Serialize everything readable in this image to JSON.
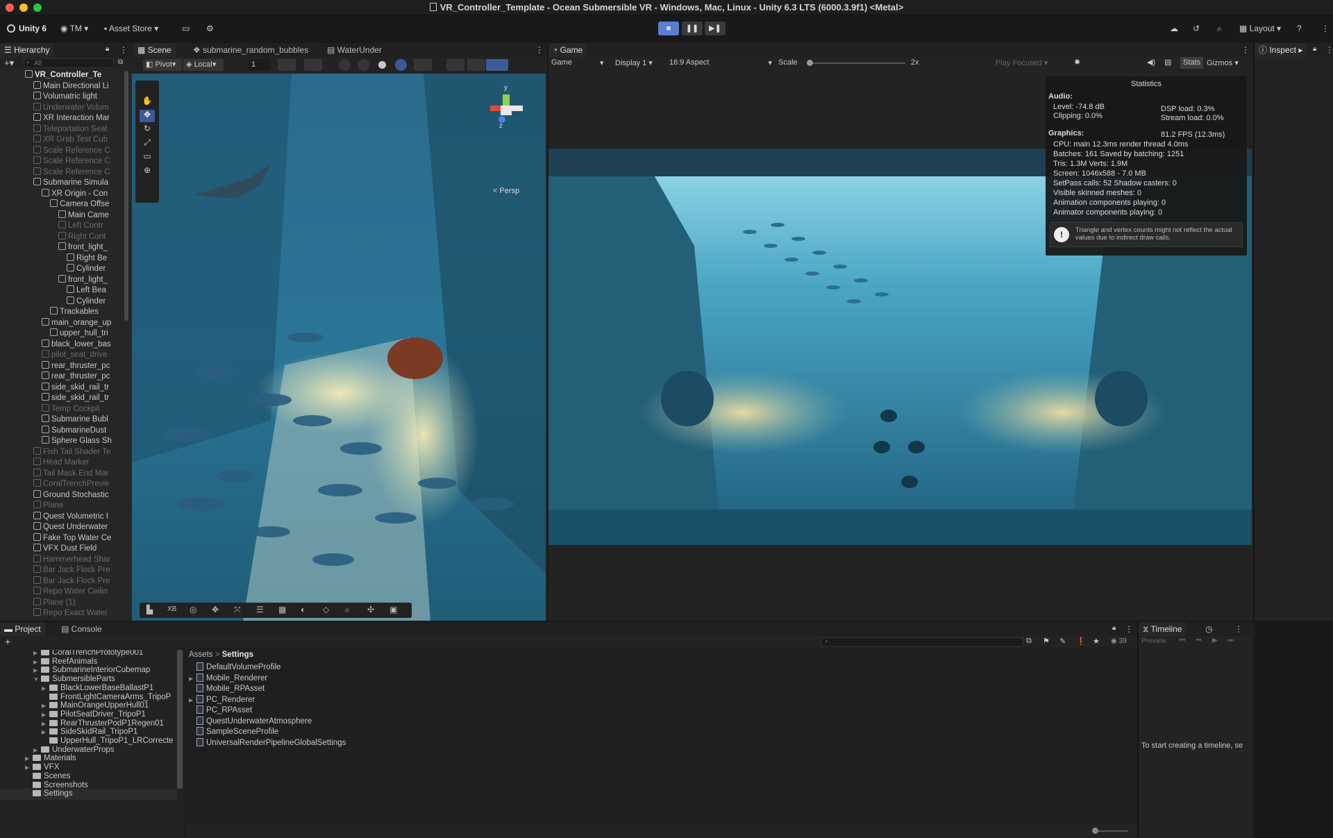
{
  "window": {
    "title": "VR_Controller_Template - Ocean Submersible VR - Windows, Mac, Linux - Unity 6.3 LTS (6000.3.9f1) <Metal>"
  },
  "toolbar": {
    "unity": "Unity 6",
    "account": "TM",
    "asset_store": "Asset Store",
    "layout": "Layout"
  },
  "scene_tabs": {
    "hierarchy": "Hierarchy",
    "scene": "Scene",
    "tab2": "submarine_random_bubbles",
    "tab3": "WaterUnder",
    "game": "Game",
    "inspector": "Inspect"
  },
  "scene_toolbar": {
    "pivot": "Pivot",
    "local": "Local",
    "snap": "1",
    "persp": "< Persp",
    "gizmo_y": "y",
    "gizmo_z": "z"
  },
  "game_toolbar": {
    "game": "Game",
    "display": "Display 1",
    "aspect": "16:9 Aspect",
    "scale": "Scale",
    "scale_val": "2x",
    "play_focused": "Play Focused",
    "stats": "Stats",
    "gizmos": "Gizmos"
  },
  "hierarchy": {
    "search_placeholder": "All",
    "items": [
      {
        "label": "VR_Controller_Te",
        "indent": 0,
        "arrow": "▼",
        "dim": false,
        "bold": true
      },
      {
        "label": "Main Directional Li",
        "indent": 1,
        "arrow": "",
        "dim": false
      },
      {
        "label": "Volumatric light",
        "indent": 1,
        "arrow": "",
        "dim": false
      },
      {
        "label": "Underwater Volum",
        "indent": 1,
        "arrow": "",
        "dim": true
      },
      {
        "label": "XR Interaction Mar",
        "indent": 1,
        "arrow": "",
        "dim": false
      },
      {
        "label": "Teleportation Seat",
        "indent": 1,
        "arrow": "",
        "dim": true
      },
      {
        "label": "XR Grab Test Cub",
        "indent": 1,
        "arrow": "",
        "dim": true
      },
      {
        "label": "Scale Reference C",
        "indent": 1,
        "arrow": "",
        "dim": true
      },
      {
        "label": "Scale Reference C",
        "indent": 1,
        "arrow": "",
        "dim": true
      },
      {
        "label": "Scale Reference C",
        "indent": 1,
        "arrow": "",
        "dim": true
      },
      {
        "label": "Submarine Simula",
        "indent": 1,
        "arrow": "▼",
        "dim": false
      },
      {
        "label": "XR Origin - Con",
        "indent": 2,
        "arrow": "▼",
        "dim": false
      },
      {
        "label": "Camera Offse",
        "indent": 3,
        "arrow": "▼",
        "dim": false
      },
      {
        "label": "Main Came",
        "indent": 4,
        "arrow": "",
        "dim": false
      },
      {
        "label": "Left Contr",
        "indent": 4,
        "arrow": "▶",
        "dim": true
      },
      {
        "label": "Right Cont",
        "indent": 4,
        "arrow": "▶",
        "dim": true
      },
      {
        "label": "front_light_",
        "indent": 4,
        "arrow": "▼",
        "dim": false
      },
      {
        "label": "Right Be",
        "indent": 5,
        "arrow": "",
        "dim": false
      },
      {
        "label": "Cylinder",
        "indent": 5,
        "arrow": "",
        "dim": false
      },
      {
        "label": "front_light_",
        "indent": 4,
        "arrow": "▼",
        "dim": false
      },
      {
        "label": "Left Bea",
        "indent": 5,
        "arrow": "",
        "dim": false
      },
      {
        "label": "Cylinder",
        "indent": 5,
        "arrow": "",
        "dim": false
      },
      {
        "label": "Trackables",
        "indent": 3,
        "arrow": "",
        "dim": false
      },
      {
        "label": "main_orange_up",
        "indent": 2,
        "arrow": "▼",
        "dim": false
      },
      {
        "label": "upper_hull_tri",
        "indent": 3,
        "arrow": "",
        "dim": false
      },
      {
        "label": "black_lower_bas",
        "indent": 2,
        "arrow": "",
        "dim": false
      },
      {
        "label": "pilot_seat_drive",
        "indent": 2,
        "arrow": "",
        "dim": true
      },
      {
        "label": "rear_thruster_pc",
        "indent": 2,
        "arrow": "",
        "dim": false
      },
      {
        "label": "rear_thruster_pc",
        "indent": 2,
        "arrow": "",
        "dim": false
      },
      {
        "label": "side_skid_rail_tr",
        "indent": 2,
        "arrow": "",
        "dim": false
      },
      {
        "label": "side_skid_rail_tr",
        "indent": 2,
        "arrow": "",
        "dim": false
      },
      {
        "label": "Temp Cockpit",
        "indent": 2,
        "arrow": "▶",
        "dim": true
      },
      {
        "label": "Submarine Bubl",
        "indent": 2,
        "arrow": "",
        "dim": false
      },
      {
        "label": "SubmarineDust",
        "indent": 2,
        "arrow": "",
        "dim": false
      },
      {
        "label": "Sphere Glass Sh",
        "indent": 2,
        "arrow": "▶",
        "dim": false
      },
      {
        "label": "Fish Tail Shader Te",
        "indent": 1,
        "arrow": "",
        "dim": true
      },
      {
        "label": "Head Marker",
        "indent": 1,
        "arrow": "",
        "dim": true
      },
      {
        "label": "Tail Mask End Mar",
        "indent": 1,
        "arrow": "",
        "dim": true
      },
      {
        "label": "CoralTrenchPrevie",
        "indent": 1,
        "arrow": "▶",
        "dim": true
      },
      {
        "label": "Ground Stochastic",
        "indent": 1,
        "arrow": "▶",
        "dim": false
      },
      {
        "label": "Plane",
        "indent": 1,
        "arrow": "",
        "dim": true
      },
      {
        "label": "Quest Volumetric I",
        "indent": 1,
        "arrow": "",
        "dim": false
      },
      {
        "label": "Quest Underwater",
        "indent": 1,
        "arrow": "▶",
        "dim": false
      },
      {
        "label": "Fake Top Water Ce",
        "indent": 1,
        "arrow": "",
        "dim": false
      },
      {
        "label": "VFX Dust Field",
        "indent": 1,
        "arrow": "",
        "dim": false
      },
      {
        "label": "Hammerhead Shar",
        "indent": 1,
        "arrow": "",
        "dim": true
      },
      {
        "label": "Bar Jack Flock Pre",
        "indent": 1,
        "arrow": "▶",
        "dim": true
      },
      {
        "label": "Bar Jack Flock Pre",
        "indent": 1,
        "arrow": "▶",
        "dim": true
      },
      {
        "label": "Repo Water Ceilin",
        "indent": 1,
        "arrow": "",
        "dim": true
      },
      {
        "label": "Plane (1)",
        "indent": 1,
        "arrow": "",
        "dim": true
      },
      {
        "label": "Repo Exact Water",
        "indent": 1,
        "arrow": "",
        "dim": true
      }
    ]
  },
  "stats": {
    "title": "Statistics",
    "audio": "Audio:",
    "level": "Level: -74.8 dB",
    "clipping": "Clipping: 0.0%",
    "dsp": "DSP load: 0.3%",
    "stream": "Stream load: 0.0%",
    "graphics": "Graphics:",
    "fps": "81.2 FPS (12.3ms)",
    "cpu": "CPU: main 12.3ms  render thread 4.0ms",
    "batches": "Batches: 161    Saved by batching: 1251",
    "tris": "Tris: 1.3M   Verts: 1.9M",
    "screen": "Screen: 1046x588 - 7.0 MB",
    "setpass": "SetPass calls: 52       Shadow casters: 0",
    "skinned": "Visible skinned meshes: 0",
    "anim": "Animation components playing: 0",
    "animator": "Animator components playing: 0",
    "warning": "Triangle and vertex counts might not reflect the actual values due to indirect draw calls."
  },
  "bottom_tabs": {
    "project": "Project",
    "console": "Console",
    "timeline": "Timeline",
    "count": "39",
    "preview": "Preview"
  },
  "project_tree": [
    {
      "label": "CoralTrenchPrototype001",
      "indent": 2,
      "arrow": "▶"
    },
    {
      "label": "ReefAnimals",
      "indent": 2,
      "arrow": "▶"
    },
    {
      "label": "SubmarineInteriorCubemap",
      "indent": 2,
      "arrow": "▶"
    },
    {
      "label": "SubmersibleParts",
      "indent": 2,
      "arrow": "▼"
    },
    {
      "label": "BlackLowerBaseBallastP1",
      "indent": 3,
      "arrow": "▶"
    },
    {
      "label": "FrontLightCameraArms_TripoP",
      "indent": 3,
      "arrow": ""
    },
    {
      "label": "MainOrangeUpperHull01",
      "indent": 3,
      "arrow": "▶"
    },
    {
      "label": "PilotSeatDriver_TripoP1",
      "indent": 3,
      "arrow": "▶"
    },
    {
      "label": "RearThrusterPodP1Regen01",
      "indent": 3,
      "arrow": "▶"
    },
    {
      "label": "SideSkidRail_TripoP1",
      "indent": 3,
      "arrow": "▶"
    },
    {
      "label": "UpperHull_TripoP1_LRCorrecte",
      "indent": 3,
      "arrow": ""
    },
    {
      "label": "UnderwaterProps",
      "indent": 2,
      "arrow": "▶"
    },
    {
      "label": "Materials",
      "indent": 1,
      "arrow": "▶"
    },
    {
      "label": "VFX",
      "indent": 1,
      "arrow": "▶"
    },
    {
      "label": "Scenes",
      "indent": 1,
      "arrow": ""
    },
    {
      "label": "Screenshots",
      "indent": 1,
      "arrow": ""
    },
    {
      "label": "Settings",
      "indent": 1,
      "arrow": "",
      "selected": true
    }
  ],
  "breadcrumb": {
    "root": "Assets",
    "sep": ">",
    "current": "Settings"
  },
  "files": [
    {
      "label": "DefaultVolumeProfile",
      "arrow": ""
    },
    {
      "label": "Mobile_Renderer",
      "arrow": "▶"
    },
    {
      "label": "Mobile_RPAsset",
      "arrow": ""
    },
    {
      "label": "PC_Renderer",
      "arrow": "▶"
    },
    {
      "label": "PC_RPAsset",
      "arrow": ""
    },
    {
      "label": "QuestUnderwaterAtmosphere",
      "arrow": ""
    },
    {
      "label": "SampleSceneProfile",
      "arrow": ""
    },
    {
      "label": "UniversalRenderPipelineGlobalSettings",
      "arrow": ""
    }
  ],
  "timeline_msg": "To start creating a timeline, se"
}
